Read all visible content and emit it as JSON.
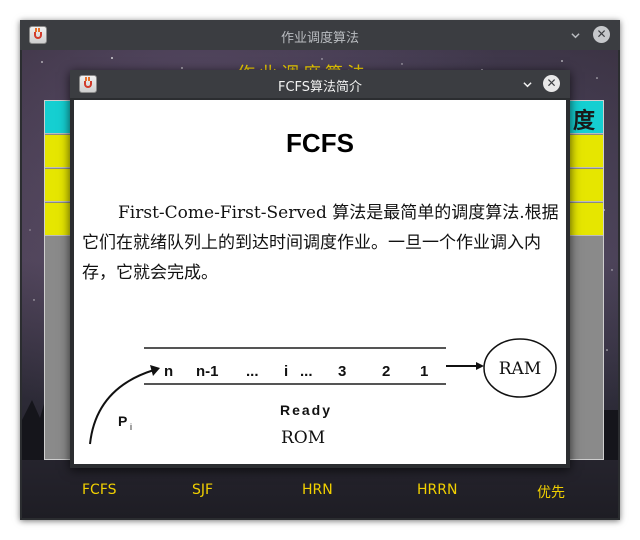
{
  "main_window": {
    "title": "作业调度算法",
    "heading_partial": "作业调度算法",
    "table_header_fragment": "度",
    "bottom_labels": [
      "FCFS",
      "SJF",
      "HRN",
      "HRRN",
      "优先"
    ]
  },
  "dialog": {
    "title": "FCFS算法简介",
    "close_glyph": "✕",
    "heading": "FCFS",
    "description": "First-Come-First-Served 算法是最简单的调度算法.根据它们在就绪队列上的到达时间调度作业。一旦一个作业调入内存，它就会完成。",
    "diagram": {
      "queue_items": [
        "n",
        "n-1",
        "...",
        "i",
        "...",
        "3",
        "2",
        "1"
      ],
      "ram_label": "RAM",
      "ready_label": "Ready",
      "rom_label": "ROM",
      "process_label": "P",
      "process_subscript": "i"
    }
  },
  "colors": {
    "titlebar": "#3b3d41",
    "table_header": "#15cfd1",
    "table_row": "#e6e600",
    "accent_text": "#f1d000"
  },
  "icons": [
    "java-app-icon",
    "chevron-down-icon",
    "close-icon"
  ]
}
